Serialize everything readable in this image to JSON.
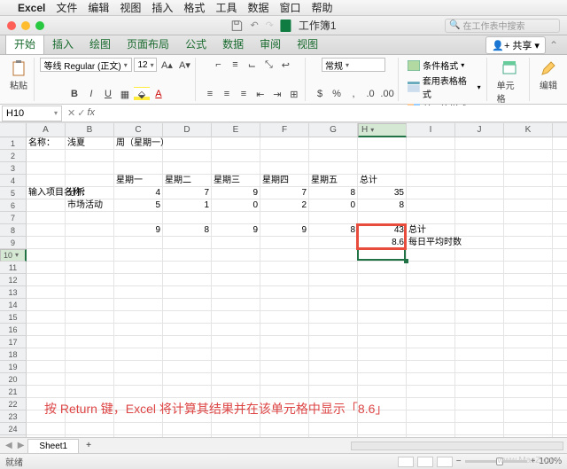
{
  "mac_menu": {
    "app": "Excel",
    "items": [
      "文件",
      "编辑",
      "视图",
      "插入",
      "格式",
      "工具",
      "数据",
      "窗口",
      "帮助"
    ]
  },
  "title": {
    "doc": "工作簿1",
    "search_ph": "在工作表中搜索"
  },
  "tabs": {
    "items": [
      "开始",
      "插入",
      "绘图",
      "页面布局",
      "公式",
      "数据",
      "审阅",
      "视图"
    ],
    "active": 0,
    "share": "共享"
  },
  "ribbon": {
    "paste": "粘贴",
    "font_name": "等线 Regular (正文)",
    "font_size": "12",
    "num_format": "常规",
    "cond": "条件格式",
    "tfmt": "套用表格格式",
    "cfmt": "单元格样式",
    "cells": "单元格",
    "edit": "编辑"
  },
  "fbar": {
    "name": "H10"
  },
  "cols": [
    "A",
    "B",
    "C",
    "D",
    "E",
    "F",
    "G",
    "H",
    "I",
    "J",
    "K",
    "L"
  ],
  "rows": 27,
  "sel_col_idx": 7,
  "sel_row_idx": 9,
  "data": {
    "1": {
      "A": "名称：",
      "B": "浅夏",
      "C": "周（星期一）"
    },
    "4": {
      "C": "星期一",
      "D": "星期二",
      "E": "星期三",
      "F": "星期四",
      "G": "星期五",
      "H": "总计"
    },
    "5": {
      "A": "输入项目名称：",
      "B": "分析",
      "C": "4",
      "D": "7",
      "E": "9",
      "F": "7",
      "G": "8",
      "H": "35"
    },
    "6": {
      "B": "市场活动",
      "C": "5",
      "D": "1",
      "E": "0",
      "F": "2",
      "G": "0",
      "H": "8"
    },
    "8": {
      "C": "9",
      "D": "8",
      "E": "9",
      "F": "9",
      "G": "8",
      "H": "43",
      "I": "总计"
    },
    "9": {
      "H": "8.6",
      "I": "每日平均时数"
    }
  },
  "sheet": {
    "tab": "Sheet1"
  },
  "status": {
    "ready": "就绪",
    "zoom": "100%"
  },
  "caption": "按 Return 键，Excel 将计算其结果并在该单元格中显示「8.6」",
  "watermark": "www.MacZ.com"
}
